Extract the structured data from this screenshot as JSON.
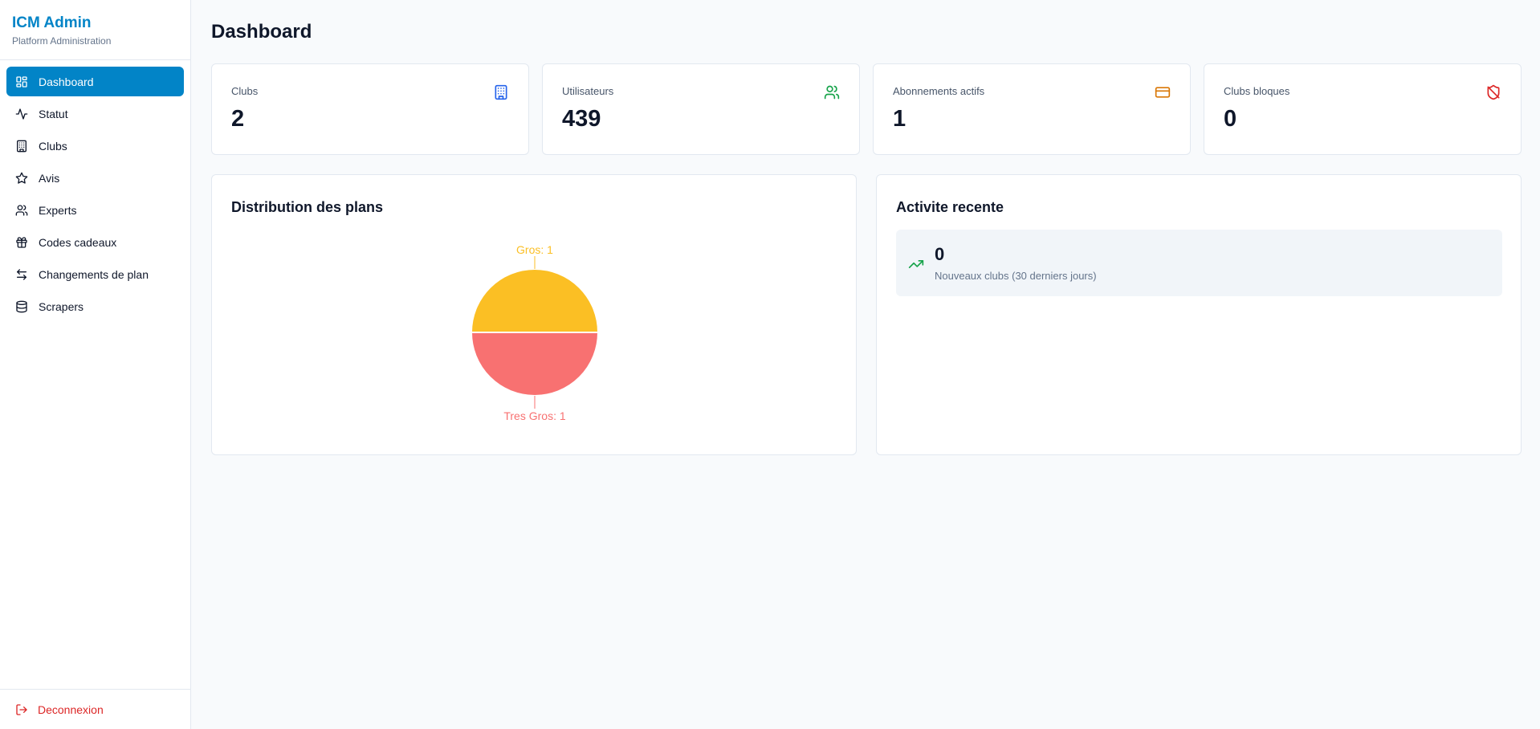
{
  "brand": {
    "title": "ICM Admin",
    "subtitle": "Platform Administration"
  },
  "nav": {
    "items": [
      {
        "label": "Dashboard",
        "icon": "layout-dashboard-icon",
        "active": true
      },
      {
        "label": "Statut",
        "icon": "activity-icon"
      },
      {
        "label": "Clubs",
        "icon": "building-icon"
      },
      {
        "label": "Avis",
        "icon": "star-icon"
      },
      {
        "label": "Experts",
        "icon": "users-icon"
      },
      {
        "label": "Codes cadeaux",
        "icon": "gift-icon"
      },
      {
        "label": "Changements de plan",
        "icon": "arrow-left-right-icon"
      },
      {
        "label": "Scrapers",
        "icon": "database-icon"
      }
    ],
    "logout": "Deconnexion"
  },
  "page": {
    "title": "Dashboard"
  },
  "stats": [
    {
      "label": "Clubs",
      "value": "2",
      "icon": "building-icon",
      "color": "#2563eb"
    },
    {
      "label": "Utilisateurs",
      "value": "439",
      "icon": "users-icon",
      "color": "#16a34a"
    },
    {
      "label": "Abonnements actifs",
      "value": "1",
      "icon": "credit-card-icon",
      "color": "#d97706"
    },
    {
      "label": "Clubs bloques",
      "value": "0",
      "icon": "shield-off-icon",
      "color": "#dc2626"
    }
  ],
  "distribution": {
    "title": "Distribution des plans"
  },
  "activity": {
    "title": "Activite recente",
    "value": "0",
    "label": "Nouveaux clubs (30 derniers jours)",
    "icon": "trending-up-icon",
    "icon_color": "#16a34a"
  },
  "chart_data": {
    "type": "pie",
    "title": "",
    "slices": [
      {
        "label": "Gros",
        "value": 1,
        "color": "#fbbf24"
      },
      {
        "label": "Tres Gros",
        "value": 1,
        "color": "#f87171"
      }
    ]
  }
}
